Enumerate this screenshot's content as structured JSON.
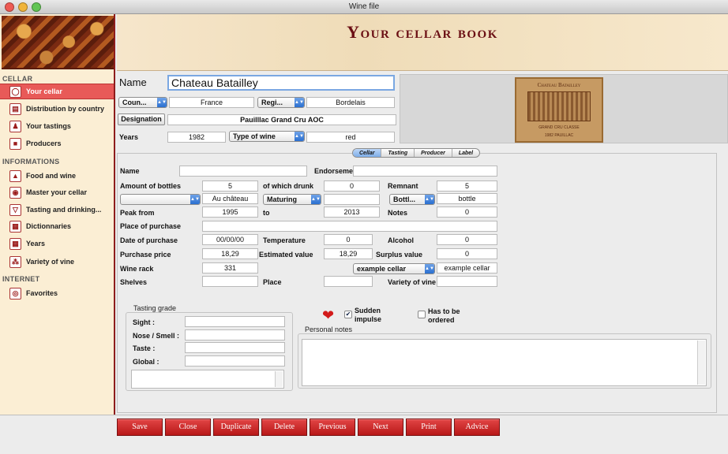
{
  "window": {
    "title": "Wine file"
  },
  "header": {
    "title": "Your cellar book"
  },
  "sidebar": {
    "sections": [
      {
        "title": "CELLAR",
        "items": [
          {
            "label": "Your cellar",
            "icon": "bottle-icon",
            "selected": true
          },
          {
            "label": "Distribution by country",
            "icon": "map-icon"
          },
          {
            "label": "Your tastings",
            "icon": "people-icon"
          },
          {
            "label": "Producers",
            "icon": "producer-icon"
          }
        ]
      },
      {
        "title": "INFORMATIONS",
        "items": [
          {
            "label": "Food and wine",
            "icon": "food-icon"
          },
          {
            "label": "Master your cellar",
            "icon": "cellar-icon"
          },
          {
            "label": "Tasting and drinking...",
            "icon": "glass-icon"
          },
          {
            "label": "Dictionnaries",
            "icon": "book-icon"
          },
          {
            "label": "Years",
            "icon": "calendar-icon"
          },
          {
            "label": "Variety of vine",
            "icon": "grape-icon"
          }
        ]
      },
      {
        "title": "INTERNET",
        "items": [
          {
            "label": "Favorites",
            "icon": "web-icon"
          }
        ]
      }
    ]
  },
  "top": {
    "name_label": "Name",
    "name_value": "Chateau Batailley",
    "country_popup": "Coun...",
    "country_value": "France",
    "region_popup": "Regi...",
    "region_value": "Bordelais",
    "designation_button": "Designation",
    "designation_value": "Pauilllac Grand Cru AOC",
    "years_label": "Years",
    "years_value": "1982",
    "type_popup": "Type of wine",
    "type_value": "red"
  },
  "wine_label": {
    "title": "Chateau Batailley",
    "subtitle": "GRAND CRU CLASSE",
    "footer": "1982 PAUILLAC"
  },
  "tabs": [
    "Cellar",
    "Tasting",
    "Producer",
    "Label"
  ],
  "active_tab": "Cellar",
  "cellar": {
    "name_label": "Name",
    "name_value": "",
    "endorsement_label": "Endorseme",
    "endorsement_value": "",
    "amount_label": "Amount of bottles",
    "amount_value": "5",
    "drunk_label": "of which drunk",
    "drunk_value": "0",
    "remnant_label": "Remnant",
    "remnant_value": "5",
    "empty_popup": "",
    "chateau_value": "Au château",
    "maturing_popup": "Maturing",
    "maturing_value": "",
    "bottle_popup": "Bottl...",
    "bottle_value": "bottle",
    "peak_label": "Peak  from",
    "peak_from": "1995",
    "to_label": "to",
    "peak_to": "2013",
    "notes_label": "Notes",
    "notes_value": "0",
    "place_purchase_label": "Place of purchase",
    "place_purchase_value": "",
    "date_label": "Date of purchase",
    "date_value": "00/00/00",
    "temperature_label": "Temperature",
    "temperature_value": "0",
    "alcohol_label": "Alcohol",
    "alcohol_value": "0",
    "price_label": "Purchase price",
    "price_value": "18,29",
    "estimated_label": "Estimated value",
    "estimated_value": "18,29",
    "surplus_label": "Surplus value",
    "surplus_value": "0",
    "rack_label": "Wine rack",
    "rack_value": "331",
    "cellar_popup": "example cellar",
    "cellar_value": "example cellar",
    "shelves_label": "Shelves",
    "shelves_value": "",
    "place_label": "Place",
    "place_value": "",
    "variety_label": "Variety of vine",
    "variety_value": ""
  },
  "tasting_grade": {
    "title": "Tasting grade",
    "rows": [
      {
        "label": "Sight :",
        "value": ""
      },
      {
        "label": "Nose / Smell :",
        "value": ""
      },
      {
        "label": "Taste :",
        "value": ""
      },
      {
        "label": "Global :",
        "value": ""
      }
    ]
  },
  "sudden_impulse": {
    "label_line1": "Sudden",
    "label_line2": "impulse",
    "checked": true
  },
  "has_to_be_ordered": {
    "label_line1": "Has to be",
    "label_line2": "ordered",
    "checked": false
  },
  "personal_notes": {
    "title": "Personal notes",
    "value": ""
  },
  "buttons": [
    "Save",
    "Close",
    "Duplicate",
    "Delete",
    "Previous",
    "Next",
    "Print",
    "Advice"
  ],
  "colors": {
    "accent": "#c61d1d",
    "selected_sidebar": "#e85a58",
    "header_text": "#6b0f14",
    "sidebar_bg": "#fbeed4"
  }
}
